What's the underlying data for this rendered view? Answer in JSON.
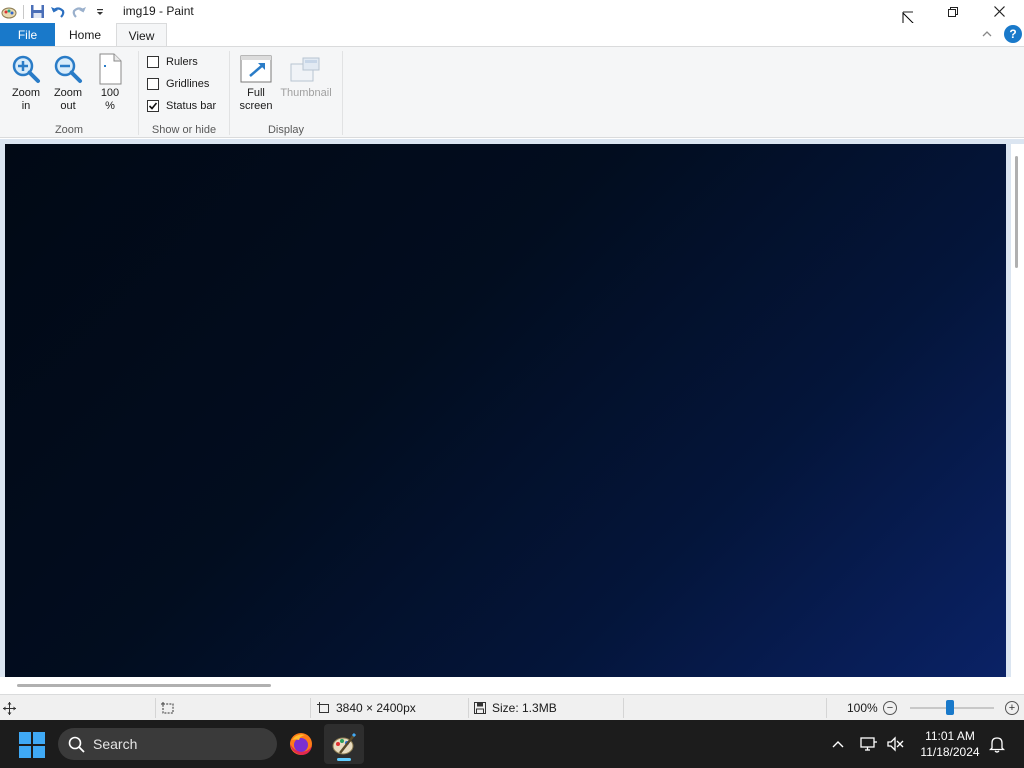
{
  "window": {
    "title": "img19 - Paint"
  },
  "tabs": {
    "file": "File",
    "home": "Home",
    "view": "View"
  },
  "help_label": "?",
  "ribbon": {
    "zoom_group": {
      "label": "Zoom",
      "zoom_in_line1": "Zoom",
      "zoom_in_line2": "in",
      "zoom_out_line1": "Zoom",
      "zoom_out_line2": "out",
      "hundred_line1": "100",
      "hundred_line2": "%"
    },
    "show_hide_group": {
      "label": "Show or hide",
      "rulers": "Rulers",
      "gridlines": "Gridlines",
      "status_bar": "Status bar",
      "rulers_checked": false,
      "gridlines_checked": false,
      "status_bar_checked": true
    },
    "display_group": {
      "label": "Display",
      "full_screen_line1": "Full",
      "full_screen_line2": "screen",
      "thumbnail": "Thumbnail"
    }
  },
  "statusbar": {
    "dimensions": "3840 × 2400px",
    "size": "Size: 1.3MB",
    "zoom_level": "100%",
    "zoom_minus": "−",
    "zoom_plus": "+"
  },
  "taskbar": {
    "search_placeholder": "Search",
    "time": "11:01 AM",
    "date": "11/18/2024"
  },
  "colors": {
    "accent": "#1979ca",
    "canvas_dark": "#010915",
    "canvas_blue": "#0a2266",
    "taskbar": "#1c1c1c"
  }
}
